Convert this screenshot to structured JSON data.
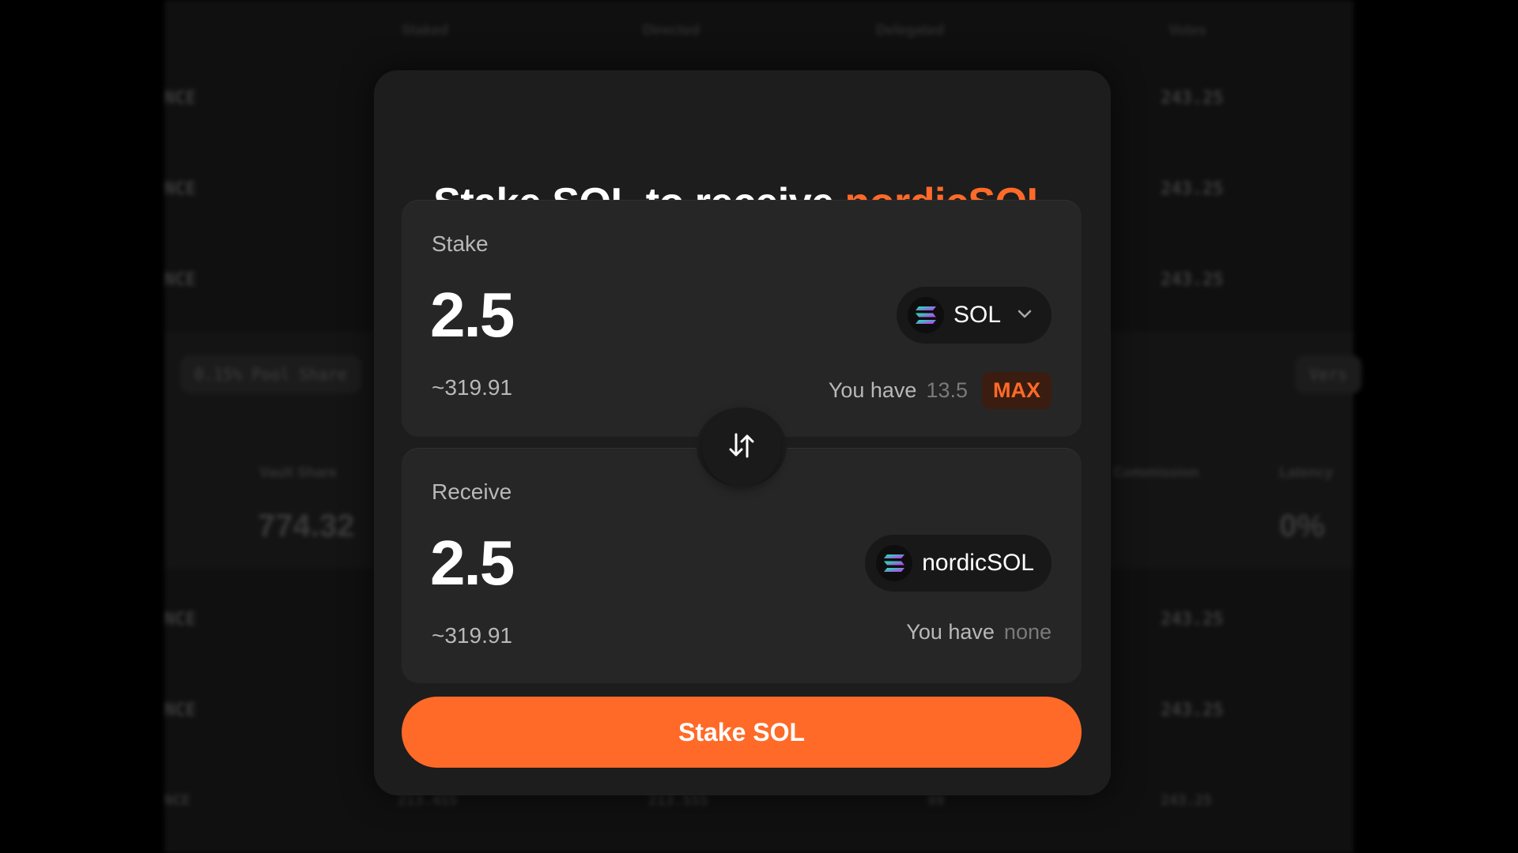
{
  "background": {
    "blurred_rows_left": [
      "NCE",
      "NCE",
      "NCE",
      "NCE",
      "NCE",
      "NCE"
    ],
    "blurred_rows_right": [
      "243.25",
      "243.25",
      "243.25",
      "243.25",
      "243.25",
      "243.25"
    ],
    "column_headers": [
      "Staked",
      "Directed",
      "Delegated",
      "Votes"
    ],
    "pool_share": "0.15% Pool Share",
    "vault_label": "Vault Share",
    "vault_value": "774.32",
    "commission_label": "Commission",
    "latency_label": "Latency",
    "latency_value": "0%",
    "version_label": "Vers",
    "bottom_values": [
      "NCE",
      "213.455",
      "213.555",
      "99",
      "243.25"
    ]
  },
  "modal": {
    "title_prefix": "Stake SOL to receive ",
    "title_accent": "nordicSOL",
    "stake": {
      "label": "Stake",
      "amount": "2.5",
      "fiat": "~319.91",
      "token": "SOL",
      "balance_label": "You have",
      "balance_value": "13.5",
      "max_label": "MAX"
    },
    "receive": {
      "label": "Receive",
      "amount": "2.5",
      "fiat": "~319.91",
      "token": "nordicSOL",
      "balance_label": "You have",
      "balance_value": "none"
    },
    "submit_label": "Stake SOL"
  },
  "colors": {
    "accent": "#ff6a28",
    "card": "#262626",
    "modal": "#1d1d1d"
  }
}
